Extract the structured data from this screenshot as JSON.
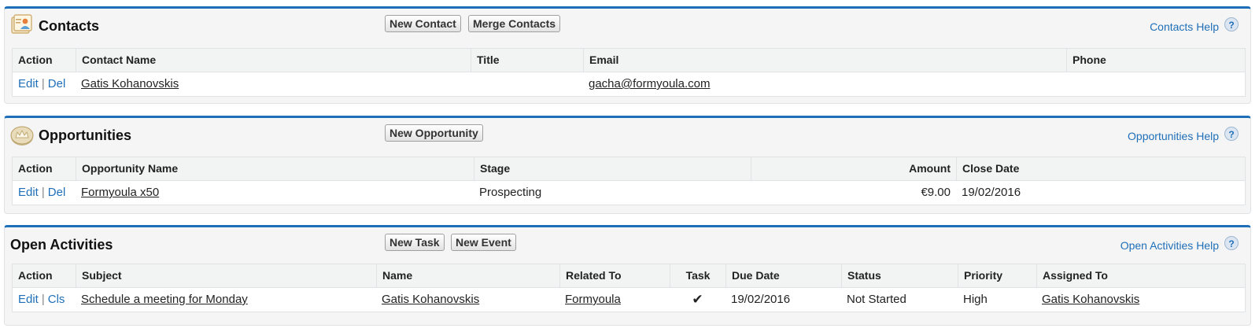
{
  "contacts": {
    "title": "Contacts",
    "buttons": {
      "new": "New Contact",
      "merge": "Merge Contacts"
    },
    "help": "Contacts Help",
    "help_glyph": "?",
    "columns": [
      "Action",
      "Contact Name",
      "Title",
      "Email",
      "Phone"
    ],
    "row": {
      "edit": "Edit",
      "sep": "|",
      "del": "Del",
      "name": "Gatis Kohanovskis",
      "title": "",
      "email": "gacha@formyoula.com",
      "phone": ""
    }
  },
  "opportunities": {
    "title": "Opportunities",
    "buttons": {
      "new": "New Opportunity"
    },
    "help": "Opportunities Help",
    "help_glyph": "?",
    "columns": [
      "Action",
      "Opportunity Name",
      "Stage",
      "Amount",
      "Close Date"
    ],
    "row": {
      "edit": "Edit",
      "sep": "|",
      "del": "Del",
      "name": "Formyoula x50",
      "stage": "Prospecting",
      "amount": "€9.00",
      "close_date": "19/02/2016"
    }
  },
  "activities": {
    "title": "Open Activities",
    "buttons": {
      "new_task": "New Task",
      "new_event": "New Event"
    },
    "help": "Open Activities Help",
    "help_glyph": "?",
    "columns": [
      "Action",
      "Subject",
      "Name",
      "Related To",
      "Task",
      "Due Date",
      "Status",
      "Priority",
      "Assigned To"
    ],
    "row": {
      "edit": "Edit",
      "sep": "|",
      "cls": "Cls",
      "subject": "Schedule a meeting for Monday",
      "name": "Gatis Kohanovskis",
      "related_to": "Formyoula",
      "task_check": "✔",
      "due_date": "19/02/2016",
      "status": "Not Started",
      "priority": "High",
      "assigned_to": "Gatis Kohanovskis"
    }
  },
  "colors": {
    "accent": "#1f6fb8",
    "panel_bg": "#f5f5f5",
    "header_bg": "#f2f3f3"
  },
  "icons": {
    "contacts": "contact-card-icon",
    "opportunities": "crown-coin-icon",
    "help": "help-question-icon"
  }
}
